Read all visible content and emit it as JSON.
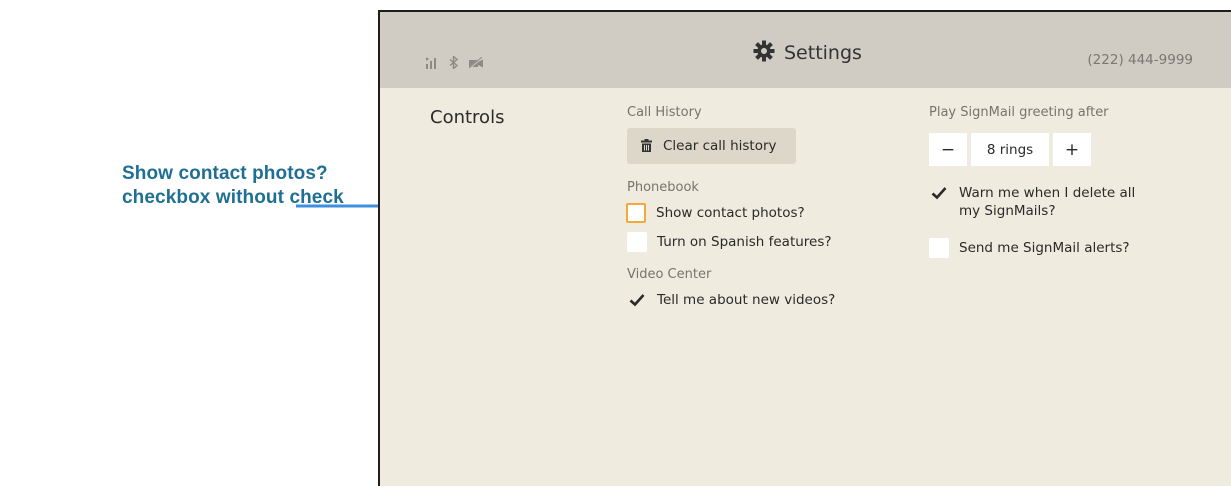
{
  "annotation": {
    "line1": "Show contact photos?",
    "line2": "checkbox without check",
    "color": "#1f6f94",
    "arrow_color": "#3d8fe0"
  },
  "header": {
    "title": "Settings",
    "phone": "(222) 444-9999",
    "status_icons": [
      "signal-icon",
      "bluetooth-icon",
      "video-off-icon"
    ],
    "title_icon": "gear-icon"
  },
  "page": {
    "section_title": "Controls"
  },
  "call_history": {
    "label": "Call History",
    "clear_button": "Clear call history",
    "clear_icon": "trash-icon"
  },
  "phonebook": {
    "label": "Phonebook",
    "show_contact_photos": {
      "label": "Show contact photos?",
      "checked": false,
      "highlighted": true
    },
    "spanish_features": {
      "label": "Turn on Spanish features?",
      "checked": false
    }
  },
  "video_center": {
    "label": "Video Center",
    "new_videos": {
      "label": "Tell me about new videos?",
      "checked": true
    }
  },
  "signmail": {
    "greeting_label": "Play SignMail greeting after",
    "decrement": "−",
    "rings_value": "8 rings",
    "increment": "+",
    "warn_delete": {
      "label_line1": "Warn me when I delete all",
      "label_line2": "my SignMails?",
      "checked": true
    },
    "alerts": {
      "label": "Send me SignMail alerts?",
      "checked": false
    }
  },
  "colors": {
    "background": "#f0ebdf",
    "topbar": "#d0ccc3",
    "button": "#ddd7c9",
    "highlight": "#f2a93c"
  }
}
